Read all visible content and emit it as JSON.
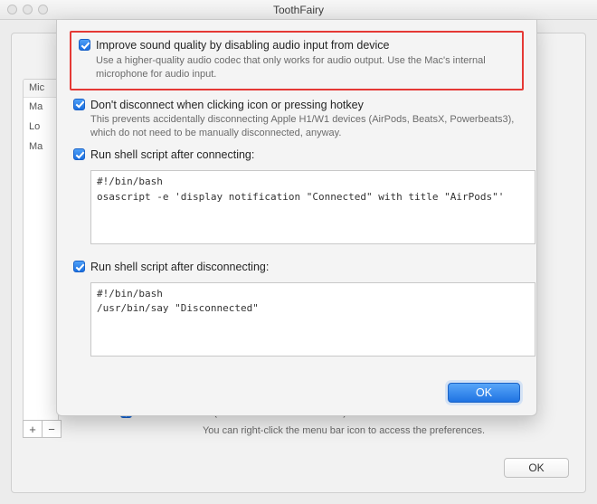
{
  "window": {
    "title": "ToothFairy"
  },
  "bg": {
    "list_header": "Mic",
    "list_rows": [
      "Ma",
      "Lo",
      "Ma"
    ],
    "add": "+",
    "remove": "−",
    "hide_checked": true,
    "hide_label": "Hide Dock icon (takes effect at next launch)",
    "hint": "You can right-click the menu bar icon to access the preferences.",
    "ok": "OK"
  },
  "sheet": {
    "opt1": {
      "checked": true,
      "label": "Improve sound quality by disabling audio input from device",
      "desc": "Use a higher-quality audio codec that only works for audio output. Use the Mac's internal microphone for audio input."
    },
    "opt2": {
      "checked": true,
      "label": "Don't disconnect when clicking icon or pressing hotkey",
      "desc": "This prevents accidentally disconnecting Apple H1/W1 devices (AirPods, BeatsX, Powerbeats3), which do not need to be manually disconnected, anyway."
    },
    "opt3": {
      "checked": true,
      "label": "Run shell script after connecting:",
      "script": "#!/bin/bash\nosascript -e 'display notification \"Connected\" with title \"AirPods\"'"
    },
    "opt4": {
      "checked": true,
      "label": "Run shell script after disconnecting:",
      "script": "#!/bin/bash\n/usr/bin/say \"Disconnected\""
    },
    "ok": "OK"
  }
}
